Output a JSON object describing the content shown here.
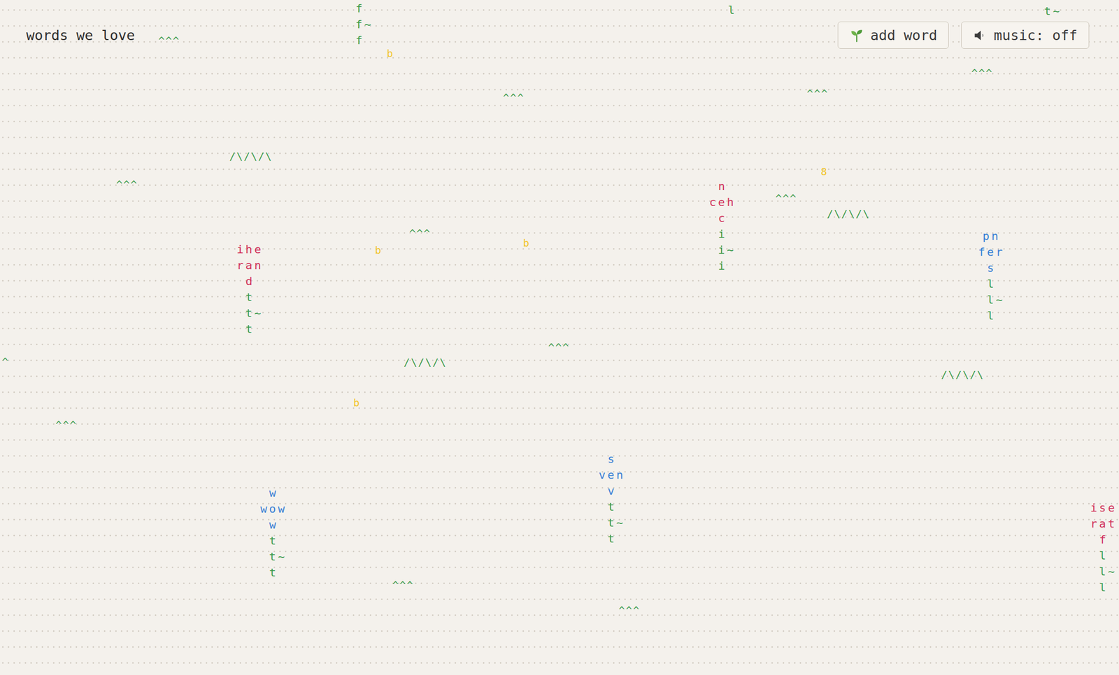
{
  "header": {
    "title": "words we love"
  },
  "buttons": [
    {
      "label": "add word"
    }
  ],
  "music": {
    "label": "music: off",
    "on": false
  },
  "plants": [
    {
      "lines": [
        {
          "text": "f",
          "color": "#3a9a4a"
        },
        {
          "text": "f~",
          "color": "#3a9a4a"
        },
        {
          "text": "f",
          "color": "#3a9a4a"
        }
      ]
    },
    {
      "lines": [
        {
          "text": "l",
          "color": "#3a9a4a"
        }
      ]
    },
    {
      "lines": [
        {
          "text": "t~",
          "color": "#3a9a4a"
        }
      ]
    },
    {
      "lines": [
        {
          "text": "n",
          "color": "#d1335b"
        },
        {
          "text": "ceh",
          "color": "#d1335b"
        },
        {
          "text": "c",
          "color": "#d1335b"
        },
        {
          "text": "i",
          "color": "#3a9a4a"
        },
        {
          "text": "i~",
          "color": "#3a9a4a"
        },
        {
          "text": "i",
          "color": "#3a9a4a"
        }
      ]
    },
    {
      "lines": [
        {
          "text": "pn",
          "color": "#3b82d6"
        },
        {
          "text": "fer",
          "color": "#3b82d6"
        },
        {
          "text": "s",
          "color": "#3b82d6"
        },
        {
          "text": "l",
          "color": "#3a9a4a"
        },
        {
          "text": "l~",
          "color": "#3a9a4a"
        },
        {
          "text": "l",
          "color": "#3a9a4a"
        }
      ]
    },
    {
      "lines": [
        {
          "text": "ihe",
          "color": "#d1335b"
        },
        {
          "text": "ran",
          "color": "#d1335b"
        },
        {
          "text": "d",
          "color": "#d1335b"
        },
        {
          "text": "t",
          "color": "#3a9a4a"
        },
        {
          "text": "t~",
          "color": "#3a9a4a"
        },
        {
          "text": "t",
          "color": "#3a9a4a"
        }
      ]
    },
    {
      "lines": [
        {
          "text": "w",
          "color": "#3b82d6"
        },
        {
          "text": "wow",
          "color": "#3b82d6"
        },
        {
          "text": "w",
          "color": "#3b82d6"
        },
        {
          "text": "t",
          "color": "#3a9a4a"
        },
        {
          "text": "t~",
          "color": "#3a9a4a"
        },
        {
          "text": "t",
          "color": "#3a9a4a"
        }
      ]
    },
    {
      "lines": [
        {
          "text": "s",
          "color": "#3b82d6"
        },
        {
          "text": "ven",
          "color": "#3b82d6"
        },
        {
          "text": "v",
          "color": "#3b82d6"
        },
        {
          "text": "t",
          "color": "#3a9a4a"
        },
        {
          "text": "t~",
          "color": "#3a9a4a"
        },
        {
          "text": "t",
          "color": "#3a9a4a"
        }
      ]
    },
    {
      "lines": [
        {
          "text": "ise",
          "color": "#d1335b"
        },
        {
          "text": "rat",
          "color": "#d1335b"
        },
        {
          "text": "f",
          "color": "#d1335b"
        },
        {
          "text": "l",
          "color": "#3a9a4a"
        },
        {
          "text": "l~",
          "color": "#3a9a4a"
        },
        {
          "text": "l",
          "color": "#3a9a4a"
        }
      ]
    }
  ],
  "decorations": [
    {
      "text": "^^^",
      "color": "#3a9a4a"
    },
    {
      "text": "^^^",
      "color": "#3a9a4a"
    },
    {
      "text": "^^^",
      "color": "#3a9a4a"
    },
    {
      "text": "^^^",
      "color": "#3a9a4a"
    },
    {
      "text": "^^^",
      "color": "#3a9a4a"
    },
    {
      "text": "^^^",
      "color": "#3a9a4a"
    },
    {
      "text": "^^^",
      "color": "#3a9a4a"
    },
    {
      "text": "^^^",
      "color": "#3a9a4a"
    },
    {
      "text": "^^^",
      "color": "#3a9a4a"
    },
    {
      "text": "^^^",
      "color": "#3a9a4a"
    },
    {
      "text": "^^^",
      "color": "#3a9a4a"
    },
    {
      "text": "/\\/\\/\\",
      "color": "#3a9a4a"
    },
    {
      "text": "/\\/\\/\\",
      "color": "#3a9a4a"
    },
    {
      "text": "/\\/\\/\\",
      "color": "#3a9a4a"
    },
    {
      "text": "/\\/\\/\\",
      "color": "#3a9a4a"
    },
    {
      "text": "b",
      "color": "#f2c62c"
    },
    {
      "text": "b",
      "color": "#f2c62c"
    },
    {
      "text": "b",
      "color": "#f2c62c"
    },
    {
      "text": "b",
      "color": "#f2c62c"
    },
    {
      "text": "8",
      "color": "#f2c62c"
    },
    {
      "text": "^",
      "color": "#3a9a4a"
    }
  ]
}
